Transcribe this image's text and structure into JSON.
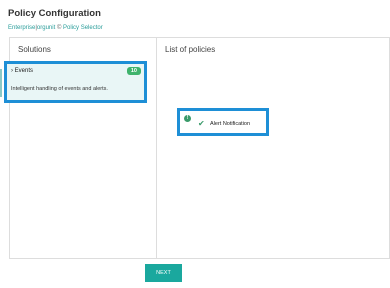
{
  "header": {
    "title": "Policy Configuration",
    "breadcrumb": {
      "root": "Enterprise",
      "sep1": "|",
      "org": "orgunit",
      "sep2": "©",
      "current": "Policy Selector"
    }
  },
  "solutions": {
    "heading": "Solutions",
    "items": [
      {
        "chevron": "›",
        "name": "Events",
        "count": "10",
        "description": "Intelligent handling of events and alerts."
      }
    ]
  },
  "policies": {
    "heading": "List of policies",
    "items": [
      {
        "info_glyph": "!",
        "check_glyph": "✔",
        "label": "Alert Notification"
      }
    ]
  },
  "footer": {
    "next_label": "NEXT"
  },
  "colors": {
    "accent": "#1aa89e",
    "highlight_border": "#1e8fd6",
    "badge": "#3fb36c"
  },
  "icons": [
    "chevron-right-icon",
    "info-icon",
    "check-icon"
  ]
}
